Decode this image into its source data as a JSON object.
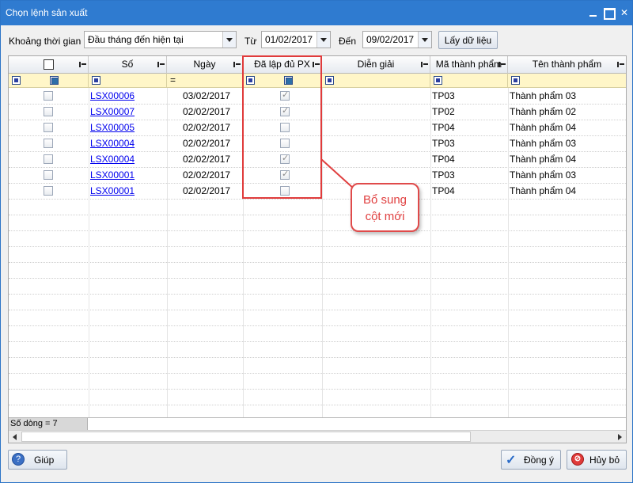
{
  "window": {
    "title": "Chọn lệnh sản xuất"
  },
  "filter": {
    "period_label": "Khoảng thời gian",
    "period_value": "Đầu tháng đến hiện tại",
    "from_label": "Từ",
    "from_value": "01/02/2017",
    "to_label": "Đến",
    "to_value": "09/02/2017",
    "fetch_label": "Lấy dữ liệu"
  },
  "grid": {
    "columns": [
      "",
      "Số",
      "Ngày",
      "Đã lập đủ PX",
      "Diễn giải",
      "Mã thành phẩm",
      "Tên thành phẩm"
    ],
    "filter_eq": "=",
    "rows": [
      {
        "so": "LSX00006",
        "ngay": "03/02/2017",
        "du_px": true,
        "dien_giai": "",
        "ma_tp": "TP03",
        "ten_tp": "Thành phẩm 03"
      },
      {
        "so": "LSX00007",
        "ngay": "02/02/2017",
        "du_px": true,
        "dien_giai": "",
        "ma_tp": "TP02",
        "ten_tp": "Thành phẩm 02"
      },
      {
        "so": "LSX00005",
        "ngay": "02/02/2017",
        "du_px": false,
        "dien_giai": "",
        "ma_tp": "TP04",
        "ten_tp": "Thành phẩm 04"
      },
      {
        "so": "LSX00004",
        "ngay": "02/02/2017",
        "du_px": false,
        "dien_giai": "",
        "ma_tp": "TP03",
        "ten_tp": "Thành phẩm 03"
      },
      {
        "so": "LSX00004",
        "ngay": "02/02/2017",
        "du_px": true,
        "dien_giai": "",
        "ma_tp": "TP04",
        "ten_tp": "Thành phẩm 04"
      },
      {
        "so": "LSX00001",
        "ngay": "02/02/2017",
        "du_px": true,
        "dien_giai": "",
        "ma_tp": "TP03",
        "ten_tp": "Thành phẩm 03"
      },
      {
        "so": "LSX00001",
        "ngay": "02/02/2017",
        "du_px": false,
        "dien_giai": "",
        "ma_tp": "TP04",
        "ten_tp": "Thành phẩm 04"
      }
    ],
    "row_count": "Số dòng = 7"
  },
  "annotation": {
    "line1": "Bổ sung",
    "line2": "cột mới",
    "color": "#e04040"
  },
  "buttons": {
    "help": "Giúp",
    "ok": "Đồng ý",
    "cancel": "Hủy bỏ"
  }
}
